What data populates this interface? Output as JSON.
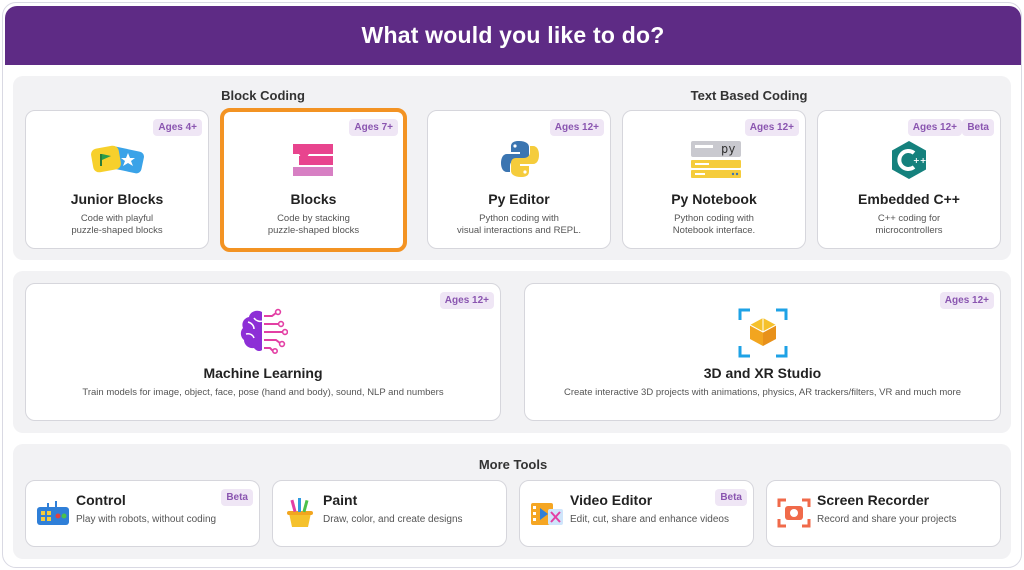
{
  "header": {
    "title": "What would you like to do?"
  },
  "block_coding": {
    "title": "Block Coding",
    "cards": [
      {
        "title": "Junior Blocks",
        "desc": "Code with playful\npuzzle-shaped blocks",
        "badge": "Ages 4+",
        "icon": "junior-blocks-icon"
      },
      {
        "title": "Blocks",
        "desc": "Code by stacking\npuzzle-shaped blocks",
        "badge": "Ages 7+",
        "icon": "blocks-icon",
        "selected": true
      }
    ]
  },
  "text_coding": {
    "title": "Text Based Coding",
    "cards": [
      {
        "title": "Py Editor",
        "desc": "Python coding with\nvisual interactions and REPL.",
        "badge": "Ages 12+",
        "icon": "python-icon"
      },
      {
        "title": "Py Notebook",
        "desc": "Python coding with\nNotebook interface.",
        "badge": "Ages 12+",
        "icon": "notebook-icon"
      },
      {
        "title": "Embedded C++",
        "desc": "C++ coding for\nmicrocontrollers",
        "badge": "Ages 12+",
        "badge2": "Beta",
        "icon": "cpp-icon"
      }
    ]
  },
  "wide_cards": [
    {
      "title": "Machine Learning",
      "desc": "Train models for image, object, face, pose (hand and body), sound, NLP and numbers",
      "badge": "Ages 12+",
      "icon": "brain-icon"
    },
    {
      "title": "3D and XR Studio",
      "desc": "Create interactive 3D projects with animations, physics, AR trackers/filters, VR and much more",
      "badge": "Ages 12+",
      "icon": "cube-ar-icon"
    }
  ],
  "more_tools": {
    "title": "More Tools",
    "items": [
      {
        "title": "Control",
        "desc": "Play with robots, without coding",
        "badge": "Beta",
        "icon": "controller-icon"
      },
      {
        "title": "Paint",
        "desc": "Draw, color, and create designs",
        "badge": "",
        "icon": "paint-icon"
      },
      {
        "title": "Video Editor",
        "desc": "Edit, cut, share and enhance videos",
        "badge": "Beta",
        "icon": "video-editor-icon"
      },
      {
        "title": "Screen Recorder",
        "desc": "Record and share your projects",
        "badge": "",
        "icon": "screen-recorder-icon"
      }
    ]
  },
  "colors": {
    "header": "#5e2b85",
    "selected_border": "#f39323",
    "badge_bg": "#efe6f5",
    "badge_text": "#8a55b0"
  }
}
